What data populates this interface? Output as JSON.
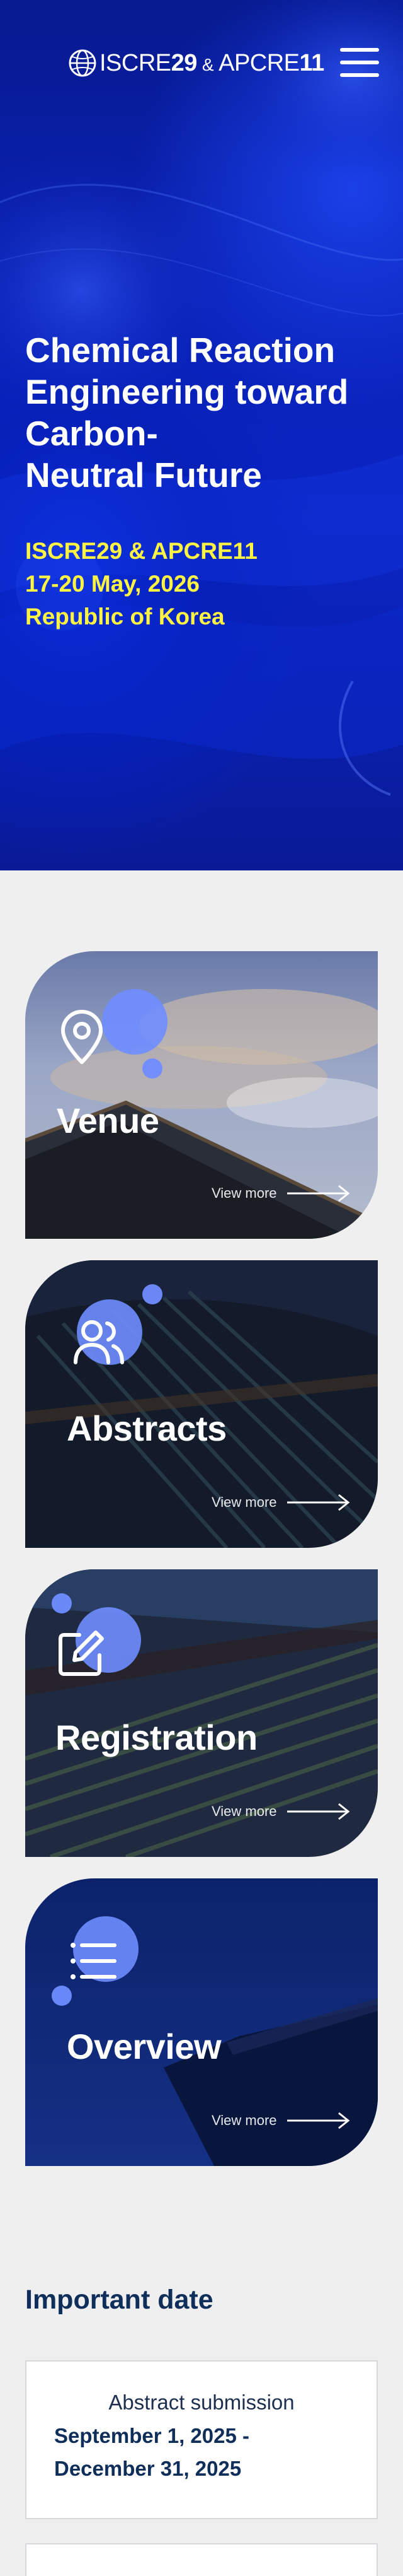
{
  "header": {
    "logo_part1": "ISCRE",
    "logo_num1": "29",
    "logo_amp": "&",
    "logo_part2": "APCRE",
    "logo_num2": "11"
  },
  "hero": {
    "title_lines": [
      "Chemical Reaction",
      "Engineering toward",
      "Carbon-",
      "Neutral Future"
    ],
    "info_lines": [
      "ISCRE29 & APCRE11",
      "17-20 May, 2026",
      "Republic of Korea"
    ]
  },
  "cards": [
    {
      "title": "Venue",
      "more_label": "View more",
      "icon": "location-pin-icon"
    },
    {
      "title": "Abstracts",
      "more_label": "View more",
      "icon": "users-icon"
    },
    {
      "title": "Registration",
      "more_label": "View more",
      "icon": "edit-icon"
    },
    {
      "title": "Overview",
      "more_label": "View more",
      "icon": "list-icon"
    }
  ],
  "important_date": {
    "title": "Important date",
    "items": [
      {
        "label": "Abstract submission",
        "value_lines": [
          "September 1, 2025 -",
          "December 31, 2025"
        ]
      }
    ]
  },
  "colors": {
    "hero_blue": "#0b25c4",
    "accent_yellow": "#fff441",
    "card_circle": "#6f8dff",
    "navy_text": "#0f2f5a"
  }
}
